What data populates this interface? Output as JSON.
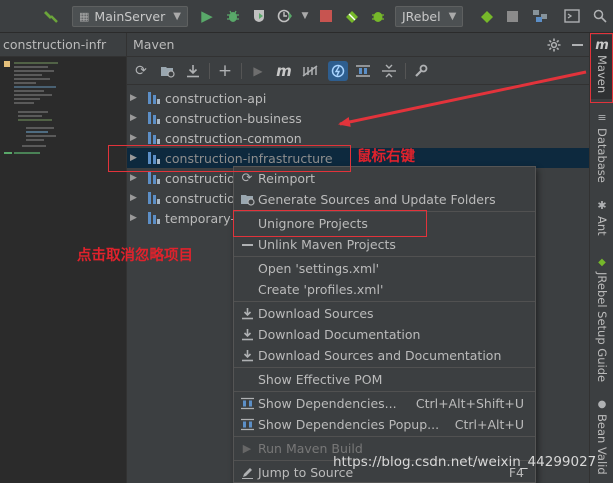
{
  "topbar": {
    "run_config": "MainServer",
    "jrebel_config": "JRebel"
  },
  "left_panel": {
    "title": "construction-infr"
  },
  "maven_panel": {
    "title": "Maven",
    "projects": [
      {
        "label": "construction-api"
      },
      {
        "label": "construction-business"
      },
      {
        "label": "construction-common"
      },
      {
        "label": "construction-infrastructure"
      },
      {
        "label": "construction"
      },
      {
        "label": "construction"
      },
      {
        "label": "temporary-"
      }
    ]
  },
  "context_menu": {
    "items": [
      {
        "label": "Reimport",
        "icon": "reimport-icon"
      },
      {
        "label": "Generate Sources and Update Folders",
        "icon": "generate-sources-icon"
      },
      {
        "label": "Unignore Projects",
        "icon": ""
      },
      {
        "label": "Unlink Maven Projects",
        "icon": "minus-icon"
      },
      {
        "label": "Open 'settings.xml'",
        "icon": ""
      },
      {
        "label": "Create 'profiles.xml'",
        "icon": ""
      },
      {
        "label": "Download Sources",
        "icon": "download-icon"
      },
      {
        "label": "Download Documentation",
        "icon": "download-icon"
      },
      {
        "label": "Download Sources and Documentation",
        "icon": "download-icon"
      },
      {
        "label": "Show Effective POM",
        "icon": ""
      },
      {
        "label": "Show Dependencies...",
        "shortcut": "Ctrl+Alt+Shift+U",
        "icon": "dependencies-icon"
      },
      {
        "label": "Show Dependencies Popup...",
        "shortcut": "Ctrl+Alt+U",
        "icon": "dependencies-icon"
      },
      {
        "label": "Run Maven Build",
        "icon": "run-icon"
      },
      {
        "label": "Jump to Source",
        "shortcut": "F4",
        "icon": "edit-icon"
      }
    ]
  },
  "right_strip": {
    "tabs": [
      {
        "label": "Maven"
      },
      {
        "label": "Database"
      },
      {
        "label": "Ant"
      },
      {
        "label": "JRebel Setup Guide"
      },
      {
        "label": "Bean Valid"
      }
    ]
  },
  "annotations": {
    "right_click": "鼠标右键",
    "click_unignore": "点击取消忽略项目"
  },
  "watermark": "https://blog.csdn.net/weixin_44299027",
  "colors": {
    "annotation_red": "#e2333b",
    "selection_bg": "#0d293e",
    "panel_bg": "#3c3f41",
    "editor_bg": "#2b2b2b"
  }
}
